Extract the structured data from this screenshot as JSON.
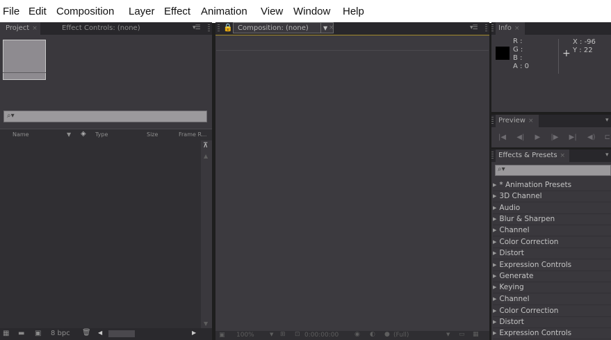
{
  "menu": [
    "File",
    "Edit",
    "Composition",
    "Layer",
    "Effect",
    "Animation",
    "View",
    "Window",
    "Help"
  ],
  "project_panel": {
    "tabs": [
      {
        "label": "Project",
        "active": true
      },
      {
        "label": "Effect Controls: (none)",
        "active": false
      }
    ],
    "search_glyph": "⌕▾",
    "columns": [
      "Name",
      "Type",
      "Size",
      "Frame R..."
    ],
    "bpc_label": "8 bpc"
  },
  "composition_panel": {
    "tab_label": "Composition: (none)",
    "zoom": "100%",
    "timecode": "0:00:00:00",
    "resolution": "(Full)"
  },
  "info_panel": {
    "tab_label": "Info",
    "r_label": "R :",
    "g_label": "G :",
    "b_label": "B :",
    "a_label": "A : 0",
    "x_label": "X : -96",
    "y_label": "Y : 22"
  },
  "preview_panel": {
    "tab_label": "Preview"
  },
  "effects_panel": {
    "tab_label": "Effects & Presets",
    "items": [
      "* Animation Presets",
      "3D Channel",
      "Audio",
      "Blur & Sharpen",
      "Channel",
      "Color Correction",
      "Distort",
      "Expression Controls",
      "Generate",
      "Keying",
      "Channel",
      "Color Correction",
      "Distort",
      "Expression Controls"
    ]
  },
  "colors": {
    "panel_bg": "#3a383d",
    "dark_bg": "#1e1e1e",
    "active_frame": "#a38a2c"
  }
}
